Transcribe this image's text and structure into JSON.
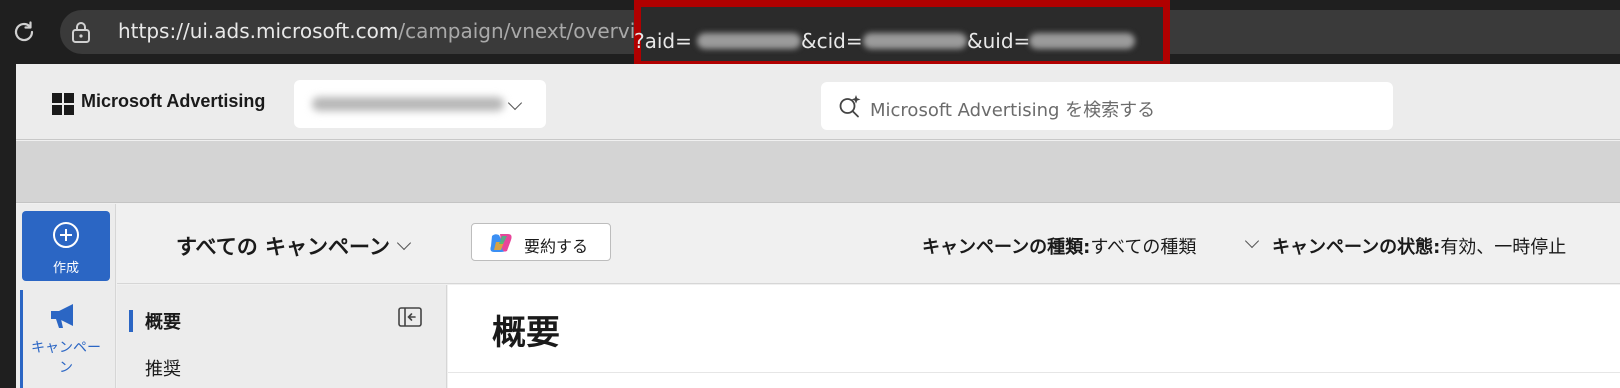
{
  "browser": {
    "url_host": "https://ui.ads.microsoft.com",
    "url_path": "/campaign/vnext/overview",
    "url_aid": "?aid=",
    "url_cid": "&cid=",
    "url_uid": "&uid=",
    "highlight_color": "#b00000"
  },
  "header": {
    "brand": "Microsoft Advertising",
    "search_placeholder": "Microsoft Advertising を検索する"
  },
  "rail": {
    "create_label": "作成",
    "campaign_label": "キャンペーン",
    "accent": "#2b66c4"
  },
  "toolbar": {
    "scope_label": "すべての キャンペーン",
    "summarize_label": "要約する",
    "filter_type_label": "キャンペーンの種類:",
    "filter_type_value": "すべての種類",
    "filter_status_label": "キャンペーンの状態:",
    "filter_status_value": "有効、一時停止"
  },
  "subnav": {
    "items": [
      {
        "label": "概要",
        "active": true
      },
      {
        "label": "推奨",
        "active": false
      }
    ]
  },
  "main": {
    "title": "概要"
  }
}
